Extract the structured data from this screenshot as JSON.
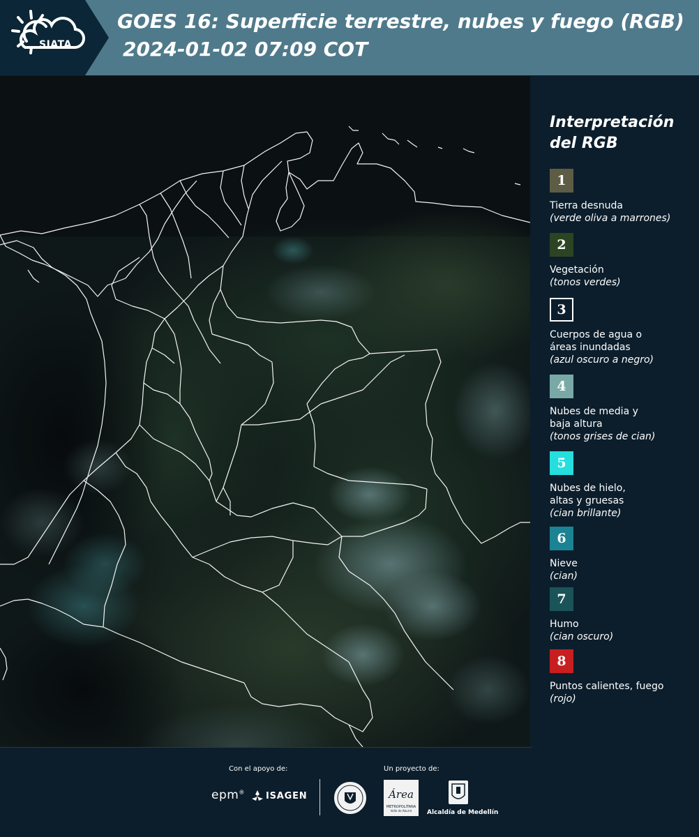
{
  "header": {
    "logo_text": "SIATA",
    "title_line1": "GOES 16: Superficie terrestre, nubes y fuego (RGB)",
    "title_line2": "2024-01-02 07:09 COT"
  },
  "map": {
    "kind": "satellite RGB composite",
    "region_lines": "department boundaries"
  },
  "legend": {
    "title_line1": "Interpretación",
    "title_line2": "del RGB",
    "items": [
      {
        "number": "1",
        "color": "#5e5c45",
        "border": "#5e5c45",
        "label": "Tierra desnuda",
        "note": "(verde oliva a marrones)"
      },
      {
        "number": "2",
        "color": "#2d4423",
        "border": "#2d4423",
        "label": "Vegetación",
        "note": "(tonos verdes)"
      },
      {
        "number": "3",
        "color": "#0c1e2c",
        "border": "#ffffff",
        "label": "Cuerpos de agua o áreas inundadas",
        "note": "(azul oscuro a negro)"
      },
      {
        "number": "4",
        "color": "#79a9a6",
        "border": "#79a9a6",
        "label": "Nubes de media y baja altura",
        "note": "(tonos grises de cian)"
      },
      {
        "number": "5",
        "color": "#25dede",
        "border": "#25dede",
        "label": "Nubes de hielo, altas y gruesas",
        "note": "(cian brillante)"
      },
      {
        "number": "6",
        "color": "#1b8393",
        "border": "#1b8393",
        "label": "Nieve",
        "note": "(cian)"
      },
      {
        "number": "7",
        "color": "#1a5458",
        "border": "#1a5458",
        "label": "Humo",
        "note": "(cian oscuro)"
      },
      {
        "number": "8",
        "color": "#c81e20",
        "border": "#c81e20",
        "label": "Puntos calientes, fuego",
        "note": "(rojo)"
      }
    ]
  },
  "footer": {
    "support_label": "Con el apoyo de:",
    "project_label": "Un proyecto de:",
    "sponsor_epm": "epm",
    "sponsor_isagen": "ISAGEN",
    "partner_area": "Área",
    "partner_area_sub": "METROPOLITANA",
    "partner_area_sub2": "Valle de Aburrá",
    "partner_alcaldia": "Alcaldía de Medellín"
  },
  "colors": {
    "header_band": "#4f7a8b",
    "header_dark": "#0b2636",
    "page_bg": "#0c1e2c",
    "map_base": "#0d1616"
  }
}
